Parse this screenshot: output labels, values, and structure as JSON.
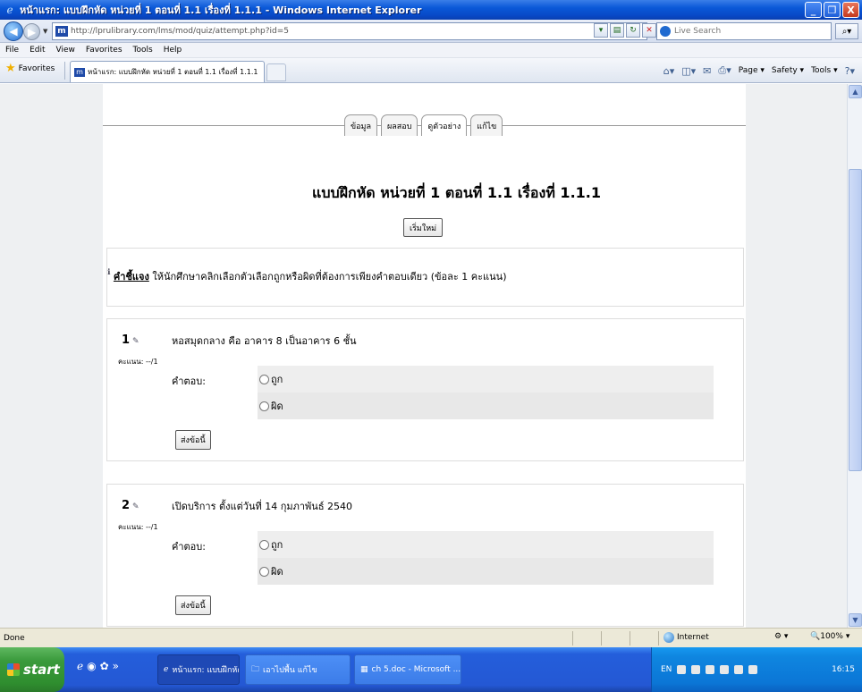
{
  "window": {
    "title": "หน้าแรก: แบบฝึกหัด หน่วยที่ 1 ตอนที่ 1.1 เรื่องที่ 1.1.1 - Windows Internet Explorer",
    "controls": [
      "_",
      "❐",
      "X"
    ]
  },
  "address_bar": {
    "url": "http://lprulibrary.com/lms/mod/quiz/attempt.php?id=5",
    "search_placeholder": "Live Search"
  },
  "menu": {
    "items": [
      "File",
      "Edit",
      "View",
      "Favorites",
      "Tools",
      "Help"
    ]
  },
  "favorites_bar": {
    "favorites_label": "Favorites",
    "tab_title": "หน้าแรก: แบบฝึกหัด หน่วยที่ 1 ตอนที่ 1.1 เรื่องที่ 1.1.1",
    "page_label": "Page ▾",
    "safety_label": "Safety ▾",
    "tools_label": "Tools ▾"
  },
  "page": {
    "tabs": [
      "ข้อมูล",
      "ผลสอบ",
      "ดูตัวอย่าง",
      "แก้ไข"
    ],
    "active_tab": "ดูตัวอย่าง",
    "title": "แบบฝึกหัด หน่วยที่ 1 ตอนที่ 1.1 เรื่องที่ 1.1.1",
    "restart_label": "เริ่มใหม่",
    "instruction_label": "คำชี้แจง",
    "instruction_text": " ให้นักศึกษาคลิกเลือกตัวเลือกถูกหรือผิดที่ต้องการเพียงคำตอบเดียว (ข้อละ 1 คะแนน)",
    "questions": [
      {
        "number": "1",
        "text": "หอสมุดกลาง คือ อาคาร 8 เป็นอาคาร 6 ชั้น",
        "marks": "คะแนน: --/1",
        "answer_label": "คำตอบ:",
        "options": [
          "ถูก",
          "ผิด"
        ],
        "submit_label": "ส่งข้อนี้"
      },
      {
        "number": "2",
        "text": "เปิดบริการ ตั้งแต่วันที่ 14 กุมภาพันธ์ 2540",
        "marks": "คะแนน: --/1",
        "answer_label": "คำตอบ:",
        "options": [
          "ถูก",
          "ผิด"
        ],
        "submit_label": "ส่งข้อนี้"
      }
    ]
  },
  "status_bar": {
    "status": "Done",
    "zone": "Internet",
    "zoom": "100%"
  },
  "taskbar": {
    "start_label": "start",
    "items": [
      "หน้าแรก: แบบฝึกหัด ห...",
      "เอาไปพื้น แก้ไข",
      "ch 5.doc - Microsoft ..."
    ],
    "language": "EN",
    "clock": "16:15"
  }
}
